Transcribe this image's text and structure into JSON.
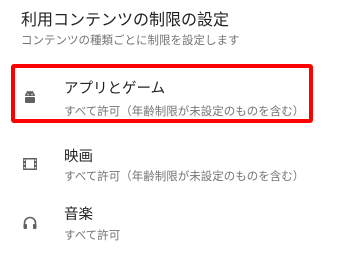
{
  "header": {
    "title": "利用コンテンツの制限の設定",
    "subtitle": "コンテンツの種類ごとに制限を設定します"
  },
  "items": [
    {
      "label": "アプリとゲーム",
      "description": "すべて許可（年齢制限が未設定のものを含む）",
      "icon": "android-icon"
    },
    {
      "label": "映画",
      "description": "すべて許可（年齢制限が未設定のものを含む）",
      "icon": "film-icon"
    },
    {
      "label": "音楽",
      "description": "すべて許可",
      "icon": "headphones-icon"
    }
  ],
  "colors": {
    "highlight": "#ff0000",
    "icon": "#616161",
    "primary_text": "#212121",
    "secondary_text": "#757575"
  }
}
